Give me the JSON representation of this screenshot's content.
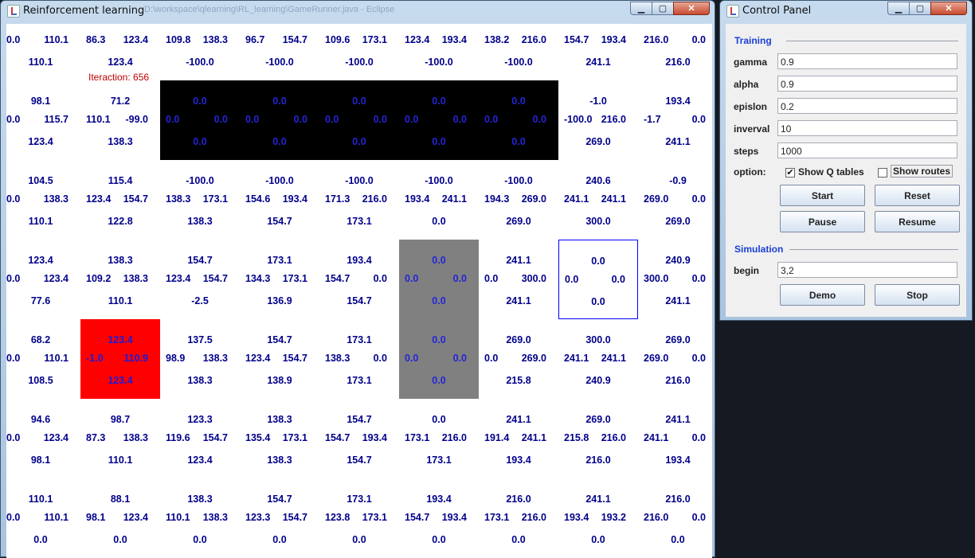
{
  "grid_window": {
    "title": "Reinforcement learning",
    "path": "D:\\workspace\\qlearning\\RL_learning\\GameRunner.java - Eclipse",
    "iteration_label": "Iteraction: 656"
  },
  "grid": {
    "cols": [
      {
        "x": -7,
        "n": "",
        "w": "",
        "e": "0.0",
        "s": ""
      },
      {
        "x": 93,
        "n": "",
        "w": "110.1",
        "e": "86.3",
        "s": ""
      }
    ],
    "rows": [
      [
        {
          "type": "normal",
          "n": "",
          "w": "0.0",
          "e": "110.1",
          "s": "110.1"
        },
        {
          "type": "normal",
          "n": "",
          "w": "86.3",
          "e": "123.4",
          "s": "123.4"
        },
        {
          "type": "normal",
          "n": "",
          "w": "109.8",
          "e": "138.3",
          "s": "-100.0"
        },
        {
          "type": "normal",
          "n": "",
          "w": "96.7",
          "e": "154.7",
          "s": "-100.0"
        },
        {
          "type": "normal",
          "n": "",
          "w": "109.6",
          "e": "173.1",
          "s": "-100.0"
        },
        {
          "type": "normal",
          "n": "",
          "w": "123.4",
          "e": "193.4",
          "s": "-100.0"
        },
        {
          "type": "normal",
          "n": "",
          "w": "138.2",
          "e": "216.0",
          "s": "-100.0"
        },
        {
          "type": "normal",
          "n": "",
          "w": "154.7",
          "e": "193.4",
          "s": "241.1"
        },
        {
          "type": "normal",
          "n": "",
          "w": "216.0",
          "e": "0.0",
          "s": "216.0"
        }
      ],
      [
        {
          "type": "normal",
          "n": "98.1",
          "w": "0.0",
          "e": "115.7",
          "s": "123.4"
        },
        {
          "type": "normal",
          "n": "71.2",
          "w": "110.1",
          "e": "-99.0",
          "s": "138.3"
        },
        {
          "type": "obstacle",
          "n": "0.0",
          "w": "0.0",
          "e": "0.0",
          "s": "0.0"
        },
        {
          "type": "obstacle",
          "n": "0.0",
          "w": "0.0",
          "e": "0.0",
          "s": "0.0"
        },
        {
          "type": "obstacle",
          "n": "0.0",
          "w": "0.0",
          "e": "0.0",
          "s": "0.0"
        },
        {
          "type": "obstacle",
          "n": "0.0",
          "w": "0.0",
          "e": "0.0",
          "s": "0.0"
        },
        {
          "type": "obstacle",
          "n": "0.0",
          "w": "0.0",
          "e": "0.0",
          "s": "0.0"
        },
        {
          "type": "normal",
          "n": "-1.0",
          "w": "-100.0",
          "e": "216.0",
          "s": "269.0"
        },
        {
          "type": "normal",
          "n": "193.4",
          "w": "-1.7",
          "e": "0.0",
          "s": "241.1"
        }
      ],
      [
        {
          "type": "normal",
          "n": "104.5",
          "w": "0.0",
          "e": "138.3",
          "s": "110.1"
        },
        {
          "type": "normal",
          "n": "115.4",
          "w": "123.4",
          "e": "154.7",
          "s": "122.8"
        },
        {
          "type": "normal",
          "n": "-100.0",
          "w": "138.3",
          "e": "173.1",
          "s": "138.3"
        },
        {
          "type": "normal",
          "n": "-100.0",
          "w": "154.6",
          "e": "193.4",
          "s": "154.7"
        },
        {
          "type": "normal",
          "n": "-100.0",
          "w": "171.3",
          "e": "216.0",
          "s": "173.1"
        },
        {
          "type": "normal",
          "n": "-100.0",
          "w": "193.4",
          "e": "241.1",
          "s": "0.0"
        },
        {
          "type": "normal",
          "n": "-100.0",
          "w": "194.3",
          "e": "269.0",
          "s": "269.0"
        },
        {
          "type": "normal",
          "n": "240.6",
          "w": "241.1",
          "e": "241.1",
          "s": "300.0"
        },
        {
          "type": "normal",
          "n": "-0.9",
          "w": "269.0",
          "e": "0.0",
          "s": "269.0"
        }
      ],
      [
        {
          "type": "normal",
          "n": "123.4",
          "w": "0.0",
          "e": "123.4",
          "s": "77.6"
        },
        {
          "type": "normal",
          "n": "138.3",
          "w": "109.2",
          "e": "138.3",
          "s": "110.1"
        },
        {
          "type": "normal",
          "n": "154.7",
          "w": "123.4",
          "e": "154.7",
          "s": "-2.5"
        },
        {
          "type": "normal",
          "n": "173.1",
          "w": "134.3",
          "e": "173.1",
          "s": "136.9"
        },
        {
          "type": "normal",
          "n": "193.4",
          "w": "154.7",
          "e": "0.0",
          "s": "154.7"
        },
        {
          "type": "wall",
          "n": "0.0",
          "w": "0.0",
          "e": "0.0",
          "s": "0.0"
        },
        {
          "type": "normal",
          "n": "241.1",
          "w": "0.0",
          "e": "300.0",
          "s": "241.1"
        },
        {
          "type": "goal",
          "n": "0.0",
          "w": "0.0",
          "e": "0.0",
          "s": "0.0"
        },
        {
          "type": "normal",
          "n": "240.9",
          "w": "300.0",
          "e": "0.0",
          "s": "241.1"
        }
      ],
      [
        {
          "type": "normal",
          "n": "68.2",
          "w": "0.0",
          "e": "110.1",
          "s": "108.5"
        },
        {
          "type": "agent",
          "n": "123.4",
          "w": "-1.0",
          "e": "110.9",
          "s": "123.4"
        },
        {
          "type": "normal",
          "n": "137.5",
          "w": "98.9",
          "e": "138.3",
          "s": "138.3"
        },
        {
          "type": "normal",
          "n": "154.7",
          "w": "123.4",
          "e": "154.7",
          "s": "138.9"
        },
        {
          "type": "normal",
          "n": "173.1",
          "w": "138.3",
          "e": "0.0",
          "s": "173.1"
        },
        {
          "type": "wall",
          "n": "0.0",
          "w": "0.0",
          "e": "0.0",
          "s": "0.0"
        },
        {
          "type": "normal",
          "n": "269.0",
          "w": "0.0",
          "e": "269.0",
          "s": "215.8"
        },
        {
          "type": "normal",
          "n": "300.0",
          "w": "241.1",
          "e": "241.1",
          "s": "240.9"
        },
        {
          "type": "normal",
          "n": "269.0",
          "w": "269.0",
          "e": "0.0",
          "s": "216.0"
        }
      ],
      [
        {
          "type": "normal",
          "n": "94.6",
          "w": "0.0",
          "e": "123.4",
          "s": "98.1"
        },
        {
          "type": "normal",
          "n": "98.7",
          "w": "87.3",
          "e": "138.3",
          "s": "110.1"
        },
        {
          "type": "normal",
          "n": "123.3",
          "w": "119.6",
          "e": "154.7",
          "s": "123.4"
        },
        {
          "type": "normal",
          "n": "138.3",
          "w": "135.4",
          "e": "173.1",
          "s": "138.3"
        },
        {
          "type": "normal",
          "n": "154.7",
          "w": "154.7",
          "e": "193.4",
          "s": "154.7"
        },
        {
          "type": "normal",
          "n": "0.0",
          "w": "173.1",
          "e": "216.0",
          "s": "173.1"
        },
        {
          "type": "normal",
          "n": "241.1",
          "w": "191.4",
          "e": "241.1",
          "s": "193.4"
        },
        {
          "type": "normal",
          "n": "269.0",
          "w": "215.8",
          "e": "216.0",
          "s": "216.0"
        },
        {
          "type": "normal",
          "n": "241.1",
          "w": "241.1",
          "e": "0.0",
          "s": "193.4"
        }
      ],
      [
        {
          "type": "normal",
          "n": "110.1",
          "w": "0.0",
          "e": "110.1",
          "s": "0.0"
        },
        {
          "type": "normal",
          "n": "88.1",
          "w": "98.1",
          "e": "123.4",
          "s": "0.0"
        },
        {
          "type": "normal",
          "n": "138.3",
          "w": "110.1",
          "e": "138.3",
          "s": "0.0"
        },
        {
          "type": "normal",
          "n": "154.7",
          "w": "123.3",
          "e": "154.7",
          "s": "0.0"
        },
        {
          "type": "normal",
          "n": "173.1",
          "w": "123.8",
          "e": "173.1",
          "s": "0.0"
        },
        {
          "type": "normal",
          "n": "193.4",
          "w": "154.7",
          "e": "193.4",
          "s": "0.0"
        },
        {
          "type": "normal",
          "n": "216.0",
          "w": "173.1",
          "e": "216.0",
          "s": "0.0"
        },
        {
          "type": "normal",
          "n": "241.1",
          "w": "193.4",
          "e": "193.2",
          "s": "0.0"
        },
        {
          "type": "normal",
          "n": "216.0",
          "w": "216.0",
          "e": "0.0",
          "s": "0.0"
        }
      ]
    ]
  },
  "control_panel": {
    "title": "Control Panel",
    "training_label": "Training",
    "fields": [
      {
        "label": "gamma",
        "value": "0.9"
      },
      {
        "label": "alpha",
        "value": "0.9"
      },
      {
        "label": "epislon",
        "value": "0.2"
      },
      {
        "label": "inverval",
        "value": "10"
      },
      {
        "label": "steps",
        "value": "1000"
      }
    ],
    "option_label": "option:",
    "show_q_tables": {
      "label": "Show Q tables",
      "checked": true,
      "mark": "✔"
    },
    "show_routes": {
      "label": "Show routes",
      "checked": false,
      "mark": ""
    },
    "buttons": {
      "start": "Start",
      "reset": "Reset",
      "pause": "Pause",
      "resume": "Resume",
      "demo": "Demo",
      "stop": "Stop"
    },
    "simulation_label": "Simulation",
    "begin_label": "begin",
    "begin_value": "3,2"
  },
  "colors": {
    "q_text": "#00008b",
    "agent": "#ff0000",
    "obstacle": "#000000",
    "wall": "#808080",
    "goal_border": "#0000ff",
    "section": "#1a3fd6"
  },
  "icons": [
    "java-app-icon",
    "minimize-icon",
    "maximize-icon",
    "close-icon",
    "checkmark-icon"
  ]
}
